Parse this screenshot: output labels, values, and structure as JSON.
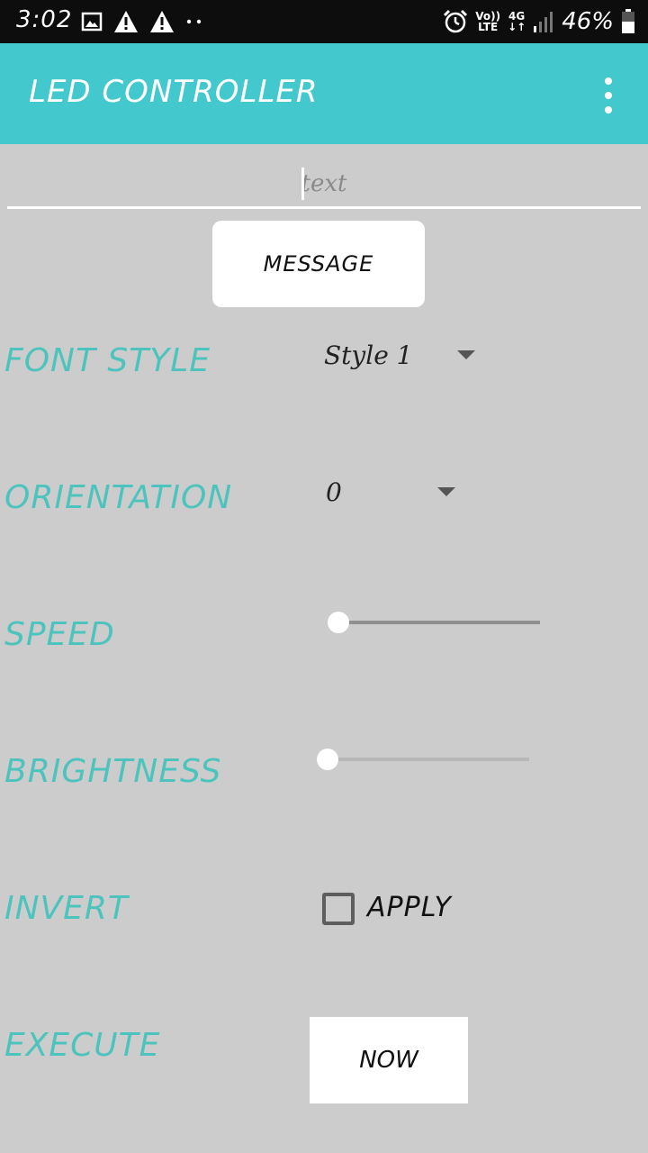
{
  "status_bar": {
    "time": "3:02",
    "network": {
      "line1": "Vo))",
      "line2": "LTE"
    },
    "data": {
      "line1": "4G",
      "line2": "↓↑"
    },
    "battery": "46%"
  },
  "app_bar": {
    "title": "LED CONTROLLER"
  },
  "message_input": {
    "placeholder": "text",
    "value": ""
  },
  "message_button": {
    "label": "MESSAGE"
  },
  "font_style": {
    "label": "FONT STYLE",
    "selected": "Style 1"
  },
  "orientation": {
    "label": "ORIENTATION",
    "selected": "0"
  },
  "speed": {
    "label": "SPEED",
    "value": 0
  },
  "brightness": {
    "label": "BRIGHTNESS",
    "value": 0
  },
  "invert": {
    "label": "INVERT",
    "checkbox_label": "APPLY",
    "checked": false
  },
  "execute": {
    "label": "EXECUTE",
    "button_label": "NOW"
  },
  "colors": {
    "accent": "#43c8cd",
    "label_teal": "#4cc4bd",
    "background": "#cccccc"
  }
}
